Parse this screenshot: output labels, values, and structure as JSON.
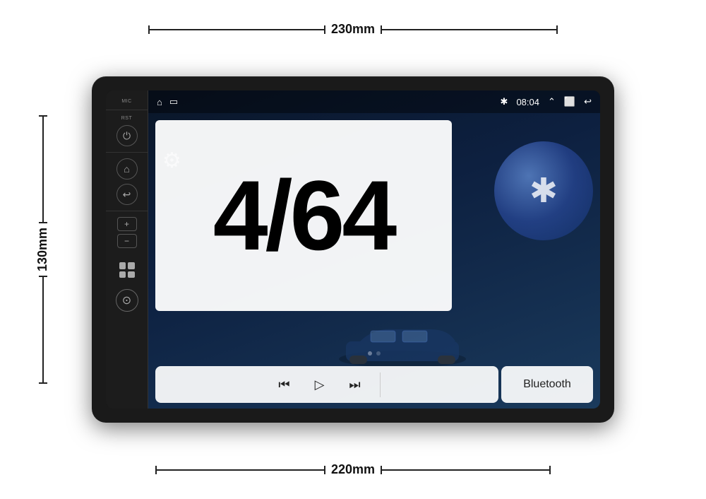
{
  "dimensions": {
    "top_label": "230mm",
    "bottom_label": "220mm",
    "side_label": "130mm"
  },
  "status_bar": {
    "home_icon": "⌂",
    "minimize_icon": "▭",
    "bluetooth_icon": "✱",
    "time": "08:04",
    "chevron_icon": "⌃",
    "window_icon": "⬜",
    "back_icon": "↩"
  },
  "sidebar": {
    "mic_label": "MIC",
    "rst_label": "RST",
    "power_icon": "⏻",
    "home_icon": "⌂",
    "back_icon": "↩",
    "vol_up": "+",
    "vol_down": "−",
    "nav_icon": "⊙"
  },
  "overlay": {
    "text": "4/64"
  },
  "media_controls": {
    "prev_icon": "⏮",
    "play_icon": "▷",
    "next_icon": "⏭",
    "bluetooth_label": "Bluetooth"
  },
  "dots": {
    "count": 2,
    "active_index": 0
  }
}
